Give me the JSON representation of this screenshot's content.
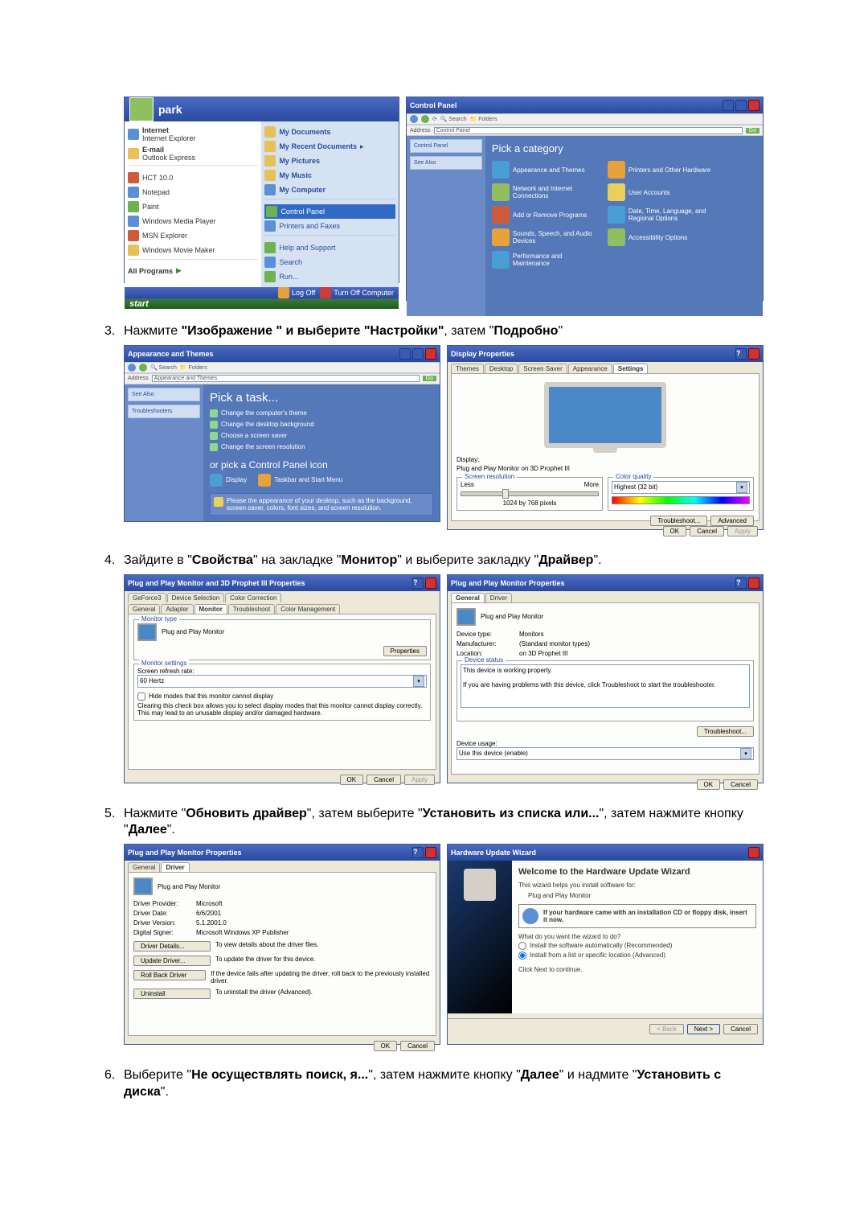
{
  "steps": {
    "s3": {
      "num": "3.",
      "pre": "Нажмите ",
      "q1": "\"Изображение \" и выберите \"Настройки\"",
      "mid": ", затем \"",
      "q2": "Подробно",
      "post": "\""
    },
    "s4": {
      "num": "4.",
      "pre": "Зайдите в \"",
      "b1": "Свойства",
      "mid1": "\" на закладке \"",
      "b2": "Монитор",
      "mid2": "\" и выберите закладку \"",
      "b3": "Драйвер",
      "post": "\"."
    },
    "s5": {
      "num": "5.",
      "pre": "Нажмите \"",
      "b1": "Обновить драйвер",
      "mid1": "\", затем выберите \"",
      "b2": "Установить из списка или...",
      "mid2": "\", затем нажмите кнопку \"",
      "b3": "Далее",
      "post": "\"."
    },
    "s6": {
      "num": "6.",
      "pre": "Выберите \"",
      "b1": "Не осуществлять поиск, я...",
      "mid1": "\", затем нажмите кнопку \"",
      "b2": "Далее",
      "mid2": "\" и надмите \"",
      "b3": "Установить с диска",
      "post": "\"."
    }
  },
  "startmenu": {
    "user": "park",
    "left": {
      "internet_t": "Internet",
      "internet_s": "Internet Explorer",
      "email_t": "E-mail",
      "email_s": "Outlook Express",
      "hct": "HCT 10.0",
      "notepad": "Notepad",
      "paint": "Paint",
      "wmp": "Windows Media Player",
      "msn": "MSN Explorer",
      "wmm": "Windows Movie Maker",
      "allprog": "All Programs"
    },
    "right": {
      "mydocs": "My Documents",
      "recent": "My Recent Documents",
      "pics": "My Pictures",
      "music": "My Music",
      "comp": "My Computer",
      "cpanel": "Control Panel",
      "printers": "Printers and Faxes",
      "help": "Help and Support",
      "search": "Search",
      "run": "Run..."
    },
    "footer": {
      "logoff": "Log Off",
      "shutdown": "Turn Off Computer"
    },
    "start": "start"
  },
  "controlpanel": {
    "title": "Control Panel",
    "addr": "Address",
    "addr_val": "Control Panel",
    "side1": "Control Panel",
    "side2": "See Also",
    "pick": "Pick a category",
    "items": [
      "Appearance and Themes",
      "Printers and Other Hardware",
      "Network and Internet Connections",
      "User Accounts",
      "Add or Remove Programs",
      "Date, Time, Language, and Regional Options",
      "Sounds, Speech, and Audio Devices",
      "Accessibility Options",
      "Performance and Maintenance"
    ]
  },
  "appthemes": {
    "title": "Appearance and Themes",
    "side1": "See Also",
    "side2": "Troubleshooters",
    "pick": "Pick a task...",
    "tasks": [
      "Change the computer's theme",
      "Change the desktop background",
      "Choose a screen saver",
      "Change the screen resolution"
    ],
    "orpick": "or pick a Control Panel icon",
    "icons": [
      "Display",
      "Taskbar and Start Menu"
    ],
    "tip": "Please the appearance of your desktop, such as the background, screen saver, colors, font sizes, and screen resolution."
  },
  "displayprop": {
    "title": "Display Properties",
    "tabs": [
      "Themes",
      "Desktop",
      "Screen Saver",
      "Appearance",
      "Settings"
    ],
    "display_lbl": "Display:",
    "display_val": "Plug and Play Monitor on 3D Prophet III",
    "res_t": "Screen resolution",
    "res_less": "Less",
    "res_more": "More",
    "res_val": "1024 by 768 pixels",
    "cq_t": "Color quality",
    "cq_val": "Highest (32 bit)",
    "btn_tr": "Troubleshoot...",
    "btn_adv": "Advanced",
    "ok": "OK",
    "cancel": "Cancel",
    "apply": "Apply"
  },
  "monitor_tab": {
    "title": "Plug and Play Monitor and 3D Prophet III Properties",
    "tabs_row1": [
      "GeForce3",
      "Device Selection",
      "Color Correction"
    ],
    "tabs_row2": [
      "General",
      "Adapter",
      "Monitor",
      "Troubleshoot",
      "Color Management"
    ],
    "mtype_t": "Monitor type",
    "mtype_v": "Plug and Play Monitor",
    "btn_props": "Properties",
    "mset_t": "Monitor settings",
    "refresh_l": "Screen refresh rate:",
    "refresh_v": "60 Hertz",
    "hide_chk": "Hide modes that this monitor cannot display",
    "hide_txt": "Clearing this check box allows you to select display modes that this monitor cannot display correctly. This may lead to an unusable display and/or damaged hardware.",
    "ok": "OK",
    "cancel": "Cancel",
    "apply": "Apply"
  },
  "driver_general": {
    "title": "Plug and Play Monitor Properties",
    "tabs": [
      "General",
      "Driver"
    ],
    "name": "Plug and Play Monitor",
    "dev_l": "Device type:",
    "dev_v": "Monitors",
    "man_l": "Manufacturer:",
    "man_v": "(Standard monitor types)",
    "loc_l": "Location:",
    "loc_v": "on 3D Prophet III",
    "status_t": "Device status",
    "status_1": "This device is working properly.",
    "status_2": "If you are having problems with this device, click Troubleshoot to start the troubleshooter.",
    "btn_tr": "Troubleshoot...",
    "usage_l": "Device usage:",
    "usage_v": "Use this device (enable)",
    "ok": "OK",
    "cancel": "Cancel"
  },
  "driver_driver": {
    "title": "Plug and Play Monitor Properties",
    "tabs": [
      "General",
      "Driver"
    ],
    "name": "Plug and Play Monitor",
    "prov_l": "Driver Provider:",
    "prov_v": "Microsoft",
    "date_l": "Driver Date:",
    "date_v": "6/6/2001",
    "ver_l": "Driver Version:",
    "ver_v": "5.1.2001.0",
    "sig_l": "Digital Signer:",
    "sig_v": "Microsoft Windows XP Publisher",
    "btns": {
      "details": {
        "l": "Driver Details...",
        "t": "To view details about the driver files."
      },
      "update": {
        "l": "Update Driver...",
        "t": "To update the driver for this device."
      },
      "roll": {
        "l": "Roll Back Driver",
        "t": "If the device fails after updating the driver, roll back to the previously installed driver."
      },
      "unin": {
        "l": "Uninstall",
        "t": "To uninstall the driver (Advanced)."
      }
    },
    "ok": "OK",
    "cancel": "Cancel"
  },
  "wizard": {
    "title": "Hardware Update Wizard",
    "welcome": "Welcome to the Hardware Update Wizard",
    "helps": "This wizard helps you install software for:",
    "device": "Plug and Play Monitor",
    "cd_note": "If your hardware came with an installation CD or floppy disk, insert it now.",
    "what": "What do you want the wizard to do?",
    "opt1": "Install the software automatically (Recommended)",
    "opt2": "Install from a list or specific location (Advanced)",
    "cont": "Click Next to continue.",
    "back": "< Back",
    "next": "Next >",
    "cancel": "Cancel"
  }
}
